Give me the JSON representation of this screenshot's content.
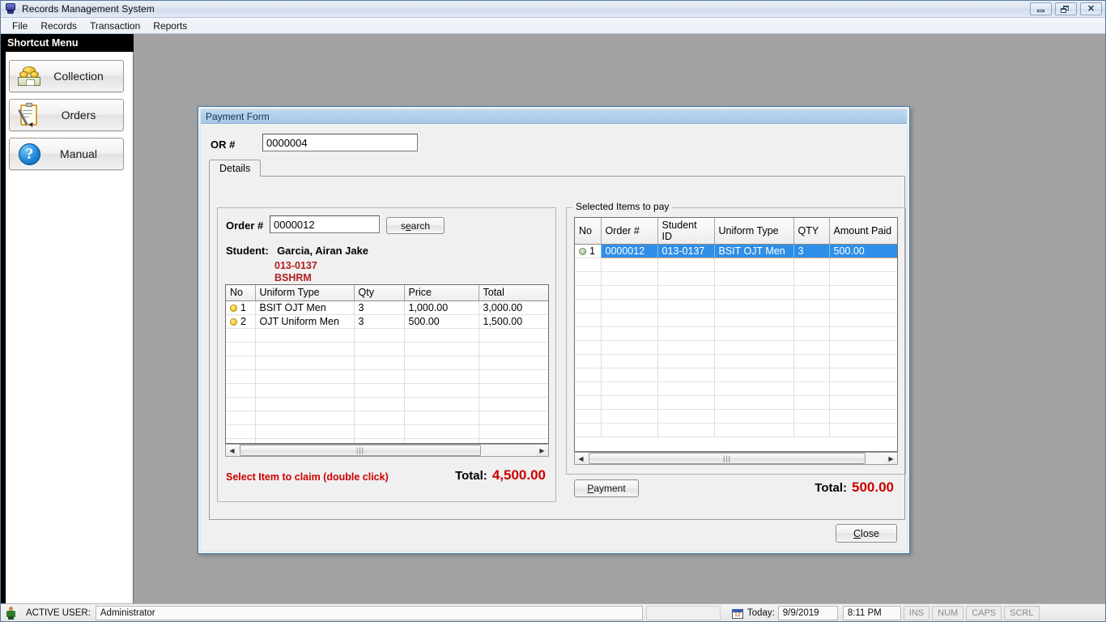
{
  "window": {
    "title": "Records Management System",
    "icon": "app-icon",
    "controls": {
      "minimize": "minimize",
      "restore": "restore",
      "close": "close"
    }
  },
  "menu": {
    "items": [
      {
        "label": "File"
      },
      {
        "label": "Records"
      },
      {
        "label": "Transaction"
      },
      {
        "label": "Reports"
      }
    ]
  },
  "sidebar": {
    "header": "Shortcut Menu",
    "items": [
      {
        "label": "Collection",
        "icon": "money-icon"
      },
      {
        "label": "Orders",
        "icon": "clipboard-pen-icon"
      },
      {
        "label": "Manual",
        "icon": "help-question-icon"
      }
    ]
  },
  "payment_form": {
    "title": "Payment Form",
    "or_label": "OR #",
    "or_value": "0000004",
    "or_placeholder": "",
    "tabs": [
      {
        "label": "Details",
        "active": true
      }
    ],
    "left": {
      "order_label": "Order #",
      "order_value": "0000012",
      "order_placeholder": "",
      "search_button": "search",
      "search_button_accel": "e",
      "student_label": "Student:",
      "student_name": "Garcia, Airan Jake",
      "student_id": "013-0137",
      "student_course": "BSHRM",
      "grid": {
        "columns": [
          "No",
          "Uniform Type",
          "Qty",
          "Price",
          "Total"
        ],
        "rows": [
          {
            "no": "1",
            "uniform_type": "BSIT OJT Men",
            "qty": "3",
            "price": "1,000.00",
            "total": "3,000.00"
          },
          {
            "no": "2",
            "uniform_type": "OJT Uniform Men",
            "qty": "3",
            "price": "500.00",
            "total": "1,500.00"
          }
        ],
        "empty_rows": 9
      },
      "hint": "Select Item to claim (double click)",
      "total_label": "Total:",
      "total_value": "4,500.00"
    },
    "right": {
      "legend": "Selected Items to pay",
      "grid": {
        "columns": [
          "No",
          "Order #",
          "Student ID",
          "Uniform Type",
          "QTY",
          "Amount Paid"
        ],
        "rows": [
          {
            "no": "1",
            "order_no": "0000012",
            "student_id": "013-0137",
            "uniform_type": "BSIT OJT Men",
            "qty": "3",
            "amount_paid": "500.00",
            "selected": true
          }
        ],
        "empty_rows": 13
      },
      "payment_button": "Payment",
      "payment_button_accel": "P",
      "total_label": "Total:",
      "total_value": "500.00"
    },
    "close_button": "Close",
    "close_button_accel": "C"
  },
  "status_bar": {
    "active_user_label": "ACTIVE USER:",
    "active_user_value": "Administrator",
    "today_label": "Today:",
    "date": "9/9/2019",
    "time": "8:11 PM",
    "keys": [
      "INS",
      "NUM",
      "CAPS",
      "SCRL"
    ]
  },
  "colors": {
    "accent_red": "#cc0000",
    "selection_blue": "#2f8fe8",
    "title_blue": "#bfd8ef",
    "desktop_gray": "#a2a2a2"
  }
}
